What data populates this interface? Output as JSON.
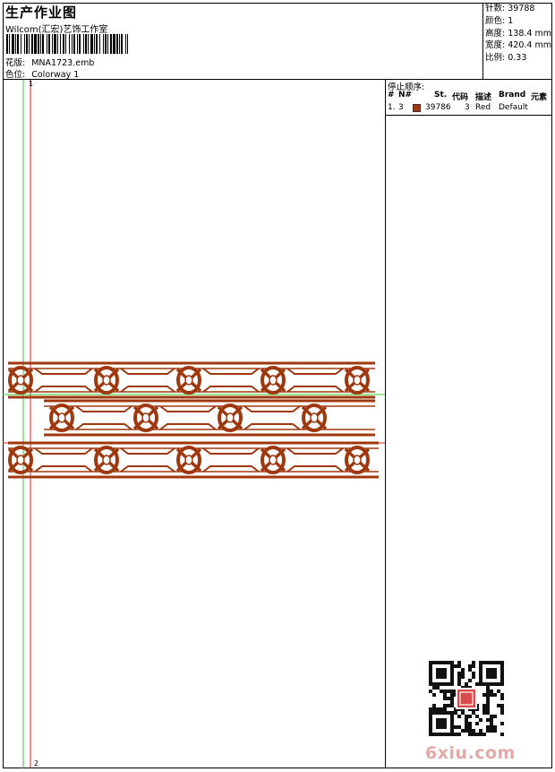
{
  "header": {
    "title": "生产作业图",
    "company": "Wilcom(汇宏)艺饰工作室",
    "design_label": "花版:",
    "design_value": "MNA1723.emb",
    "colorway_label": "色位:",
    "colorway_value": "Colorway 1"
  },
  "stats": [
    {
      "label": "针数:",
      "value": "39788"
    },
    {
      "label": "颜色:",
      "value": "1"
    },
    {
      "label": "高度:",
      "value": "138.4 mm"
    },
    {
      "label": "宽度:",
      "value": "420.4 mm"
    },
    {
      "label": "比例:",
      "value": "0.33"
    }
  ],
  "stop_sequence": {
    "title": "停止顺序:",
    "columns": [
      "#",
      "N#",
      "St.",
      "代码",
      "描述",
      "Brand",
      "元素"
    ],
    "rows": [
      {
        "index": "1.",
        "needle": "3",
        "stitches": "39786",
        "code": "3",
        "description": "Red",
        "brand": "Default",
        "element": "",
        "color": "#a0380f"
      }
    ]
  },
  "canvas": {
    "marker_top": "1",
    "marker_bottom": "2"
  },
  "colors": {
    "thread": "#a0380f",
    "guide_green": "#33cc33",
    "guide_red": "#e02020"
  },
  "watermark": "6xiu.com"
}
